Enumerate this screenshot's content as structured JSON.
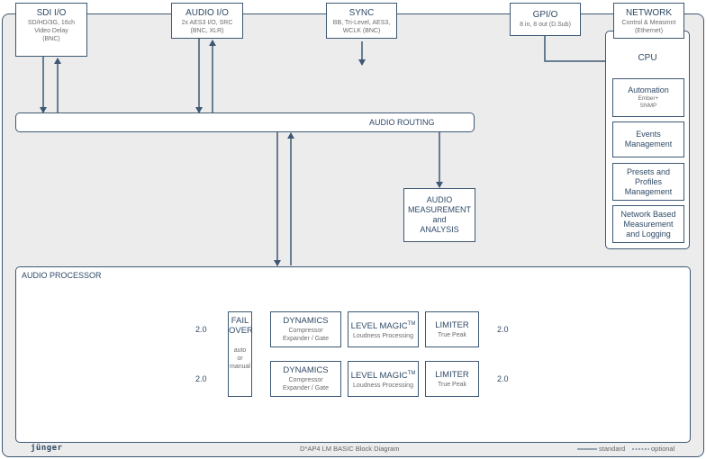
{
  "diagram": {
    "title": "D*AP4 LM BASIC Block Diagram",
    "brand": "jünger",
    "colors": {
      "line": "#3d5874",
      "text": "#2f4a66",
      "background": "#ececec",
      "box": "#ffffff"
    },
    "top_blocks": {
      "sdi": {
        "title": "SDI I/O",
        "lines": [
          "SD/HD/3G, 16ch",
          "Video Delay",
          "(BNC)"
        ]
      },
      "audio_io": {
        "title": "AUDIO I/O",
        "lines": [
          "2x AES3 I/O, SRC",
          "(BNC, XLR)"
        ]
      },
      "sync": {
        "title": "SYNC",
        "lines": [
          "BB, Tri-Level, AES3,",
          "WCLK (BNC)"
        ]
      },
      "gpio": {
        "title": "GPI/O",
        "lines": [
          "8 in, 8 out (D.Sub)"
        ]
      },
      "network": {
        "title": "NETWORK",
        "lines": [
          "Control & Measmnt",
          "(Ethernet)"
        ]
      }
    },
    "cpu": {
      "title": "CPU",
      "items": [
        {
          "title": "Automation",
          "sub": [
            "Ember+",
            "SNMP"
          ]
        },
        {
          "title": "Events Management",
          "sub": []
        },
        {
          "title": "Presets and Profiles Management",
          "sub": []
        },
        {
          "title": "Network Based Measurement and Logging",
          "sub": []
        }
      ]
    },
    "routing": {
      "label": "AUDIO ROUTING"
    },
    "measurement": {
      "lines": [
        "AUDIO",
        "MEASUREMENT",
        "and",
        "ANALYSIS"
      ]
    },
    "processor": {
      "label": "AUDIO PROCESSOR",
      "failover": {
        "title_lines": [
          "FAIL",
          "OVER"
        ],
        "sub_lines": [
          "auto",
          "or",
          "manual"
        ]
      },
      "channels": [
        {
          "input": "2.0",
          "output": "2.0",
          "dynamics": {
            "title": "DYNAMICS",
            "sub": [
              "Compressor",
              "Expander / Gate"
            ]
          },
          "level_magic": {
            "title": "LEVEL MAGIC",
            "tm": "TM",
            "sub": "Loudness Processing"
          },
          "limiter": {
            "title": "LIMITER",
            "sub": "True Peak"
          }
        },
        {
          "input": "2.0",
          "output": "2.0",
          "dynamics": {
            "title": "DYNAMICS",
            "sub": [
              "Compressor",
              "Expander / Gate"
            ]
          },
          "level_magic": {
            "title": "LEVEL MAGIC",
            "tm": "TM",
            "sub": "Loudness Processing"
          },
          "limiter": {
            "title": "LIMITER",
            "sub": "True Peak"
          }
        }
      ]
    },
    "legend": {
      "standard": "standard",
      "optional": "optional"
    }
  }
}
